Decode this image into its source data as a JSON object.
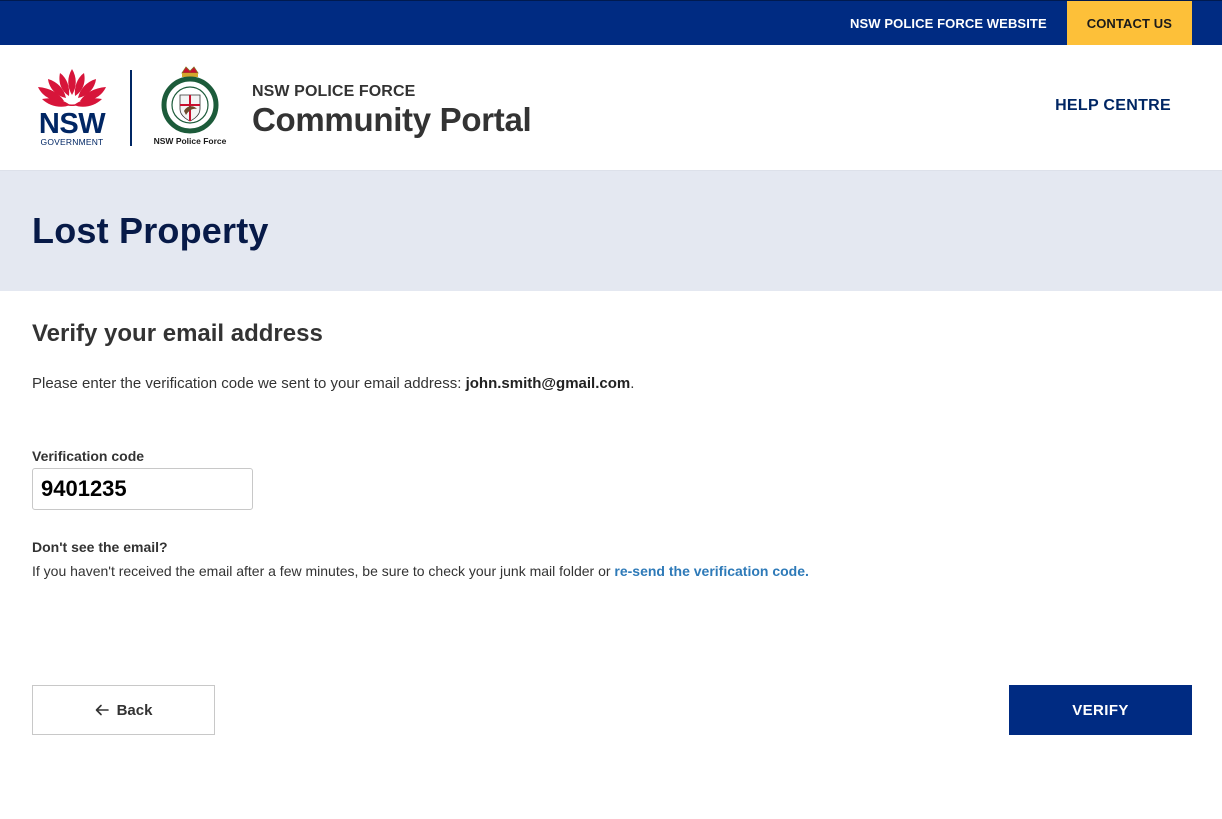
{
  "topbar": {
    "website_link": "NSW POLICE FORCE WEBSITE",
    "contact_link": "CONTACT US"
  },
  "header": {
    "nsw_logo_word": "NSW",
    "nsw_logo_sub": "GOVERNMENT",
    "police_logo_caption": "NSW Police Force",
    "portal_subtitle": "NSW POLICE FORCE",
    "portal_title": "Community Portal",
    "help_link": "HELP CENTRE"
  },
  "banner": {
    "title": "Lost Property"
  },
  "main": {
    "heading": "Verify your email address",
    "instruction_text": "Please enter the verification code we sent to your email address: ",
    "email": "john.smith@gmail.com",
    "instruction_end": ".",
    "field_label": "Verification code",
    "code_value": "9401235",
    "help_heading": "Don't see the email?",
    "help_text": "If you haven't received the email after a few minutes, be sure to check your junk mail folder or ",
    "resend_link": "re-send the verification code."
  },
  "actions": {
    "back_label": "Back",
    "verify_label": "VERIFY"
  },
  "colors": {
    "navy": "#002b82",
    "accent_yellow": "#fdc039",
    "banner_bg": "#e4e8f1",
    "link_blue": "#2e7ab8",
    "nsw_red": "#d7153a"
  },
  "icons": {
    "back": "arrow-left-icon",
    "waratah": "waratah-icon",
    "police_crest": "police-crest-icon"
  }
}
